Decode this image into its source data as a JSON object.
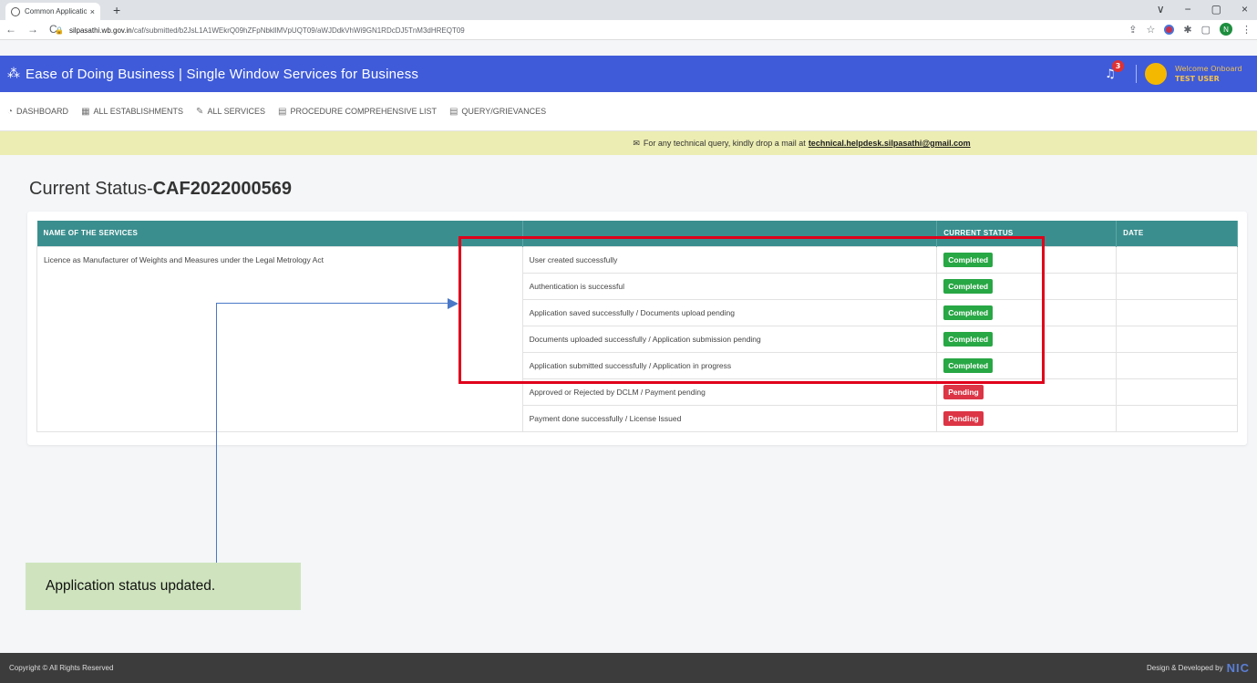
{
  "browser": {
    "tab_title": "Common Application Form Prev",
    "tab_close": "×",
    "new_tab": "+",
    "url_host": "silpasathi.wb.gov.in",
    "url_path": "/caf/submitted/b2JsL1A1WEkrQ09hZFpNbkllMVpUQT09/aWJDdkVhWi9GN1RDcDJ5TnM3dHREQT09",
    "window_controls": [
      "∨",
      "−",
      "▢",
      "×"
    ],
    "nav": [
      "←",
      "→",
      "C"
    ],
    "ext_profile": "N"
  },
  "header": {
    "title": "Ease of Doing Business | Single Window Services for Business",
    "notification_count": "3",
    "welcome": "Welcome Onboard",
    "user_name": "TEST USER"
  },
  "menu": {
    "items": [
      {
        "label": "Dashboard",
        "icon": "gauge-icon"
      },
      {
        "label": "All Establishments",
        "icon": "building-icon"
      },
      {
        "label": "All Services",
        "icon": "wrench-icon"
      },
      {
        "label": "Procedure Comprehensive List",
        "icon": "list-icon"
      },
      {
        "label": "Query/Grievances",
        "icon": "list-icon"
      }
    ]
  },
  "notice": {
    "text": "For any technical query, kindly drop a mail at",
    "email": "technical.helpdesk.silpasathi@gmail.com"
  },
  "page": {
    "title_prefix": "Current Status-",
    "caf_number": "CAF2022000569"
  },
  "table": {
    "headers": [
      "NAME OF THE SERVICES",
      "",
      "CURRENT STATUS",
      "DATE"
    ],
    "service_name": "Licence as Manufacturer of Weights and Measures under the Legal Metrology Act",
    "rows": [
      {
        "step": "User created successfully",
        "status": "Completed",
        "date": ""
      },
      {
        "step": "Authentication is successful",
        "status": "Completed",
        "date": ""
      },
      {
        "step": "Application saved successfully / Documents upload pending",
        "status": "Completed",
        "date": ""
      },
      {
        "step": "Documents uploaded successfully / Application submission pending",
        "status": "Completed",
        "date": ""
      },
      {
        "step": "Application submitted successfully / Application in progress",
        "status": "Completed",
        "date": ""
      },
      {
        "step": "Approved or Rejected by DCLM / Payment pending",
        "status": "Pending",
        "date": ""
      },
      {
        "step": "Payment done successfully / License Issued",
        "status": "Pending",
        "date": ""
      }
    ]
  },
  "annotation": {
    "note": "Application status updated."
  },
  "footer": {
    "copyright": "Copyright © All Rights Reserved",
    "developed_by": "Design & Developed by",
    "developer_logo": "NIC"
  },
  "colors": {
    "header_bg": "#3f5bd9",
    "table_header_bg": "#3b8e8e",
    "completed": "#28a745",
    "pending": "#dc3545",
    "annotation_box": "#e0001b",
    "notice_bg": "#ecedb2"
  }
}
